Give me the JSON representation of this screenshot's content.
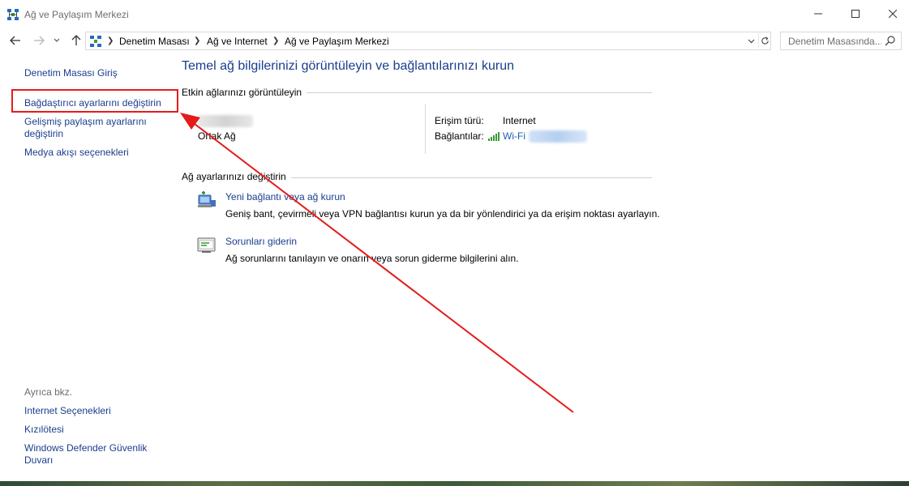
{
  "window": {
    "title": "Ağ ve Paylaşım Merkezi",
    "controls": {
      "minimize_icon": "minimize-icon",
      "maximize_icon": "maximize-icon",
      "close_icon": "close-icon"
    }
  },
  "address_bar": {
    "breadcrumbs": [
      "Denetim Masası",
      "Ağ ve Internet",
      "Ağ ve Paylaşım Merkezi"
    ],
    "search_placeholder": "Denetim Masasında..."
  },
  "sidebar": {
    "links": {
      "home": "Denetim Masası Giriş",
      "adapter": "Bağdaştırıcı ayarlarını değiştirin",
      "advanced": "Gelişmiş paylaşım ayarlarını değiştirin",
      "media": "Medya akışı seçenekleri"
    },
    "see_also": {
      "label": "Ayrıca bkz.",
      "internet_options": "Internet Seçenekleri",
      "infrared": "Kızılötesi",
      "firewall": "Windows Defender Güvenlik Duvarı"
    }
  },
  "main": {
    "title": "Temel ağ bilgilerinizi görüntüleyin ve bağlantılarınızı kurun",
    "active_networks": {
      "heading": "Etkin ağlarınızı görüntüleyin",
      "network_type": "Ortak Ağ",
      "access_label": "Erişim türü:",
      "access_value": "Internet",
      "connections_label": "Bağlantılar:",
      "connection_value": "Wi-Fi"
    },
    "change_settings": {
      "heading": "Ağ ayarlarınızı değiştirin",
      "new_connection": {
        "title": "Yeni bağlantı veya ağ kurun",
        "description": "Geniş bant, çevirmeli veya VPN bağlantısı kurun ya da bir yönlendirici ya da erişim noktası ayarlayın."
      },
      "troubleshoot": {
        "title": "Sorunları giderin",
        "description": "Ağ sorunlarını tanılayın ve onarın veya sorun giderme bilgilerini alın."
      }
    }
  },
  "colors": {
    "link": "#1a3e8c",
    "annotation": "#e41c1c"
  }
}
